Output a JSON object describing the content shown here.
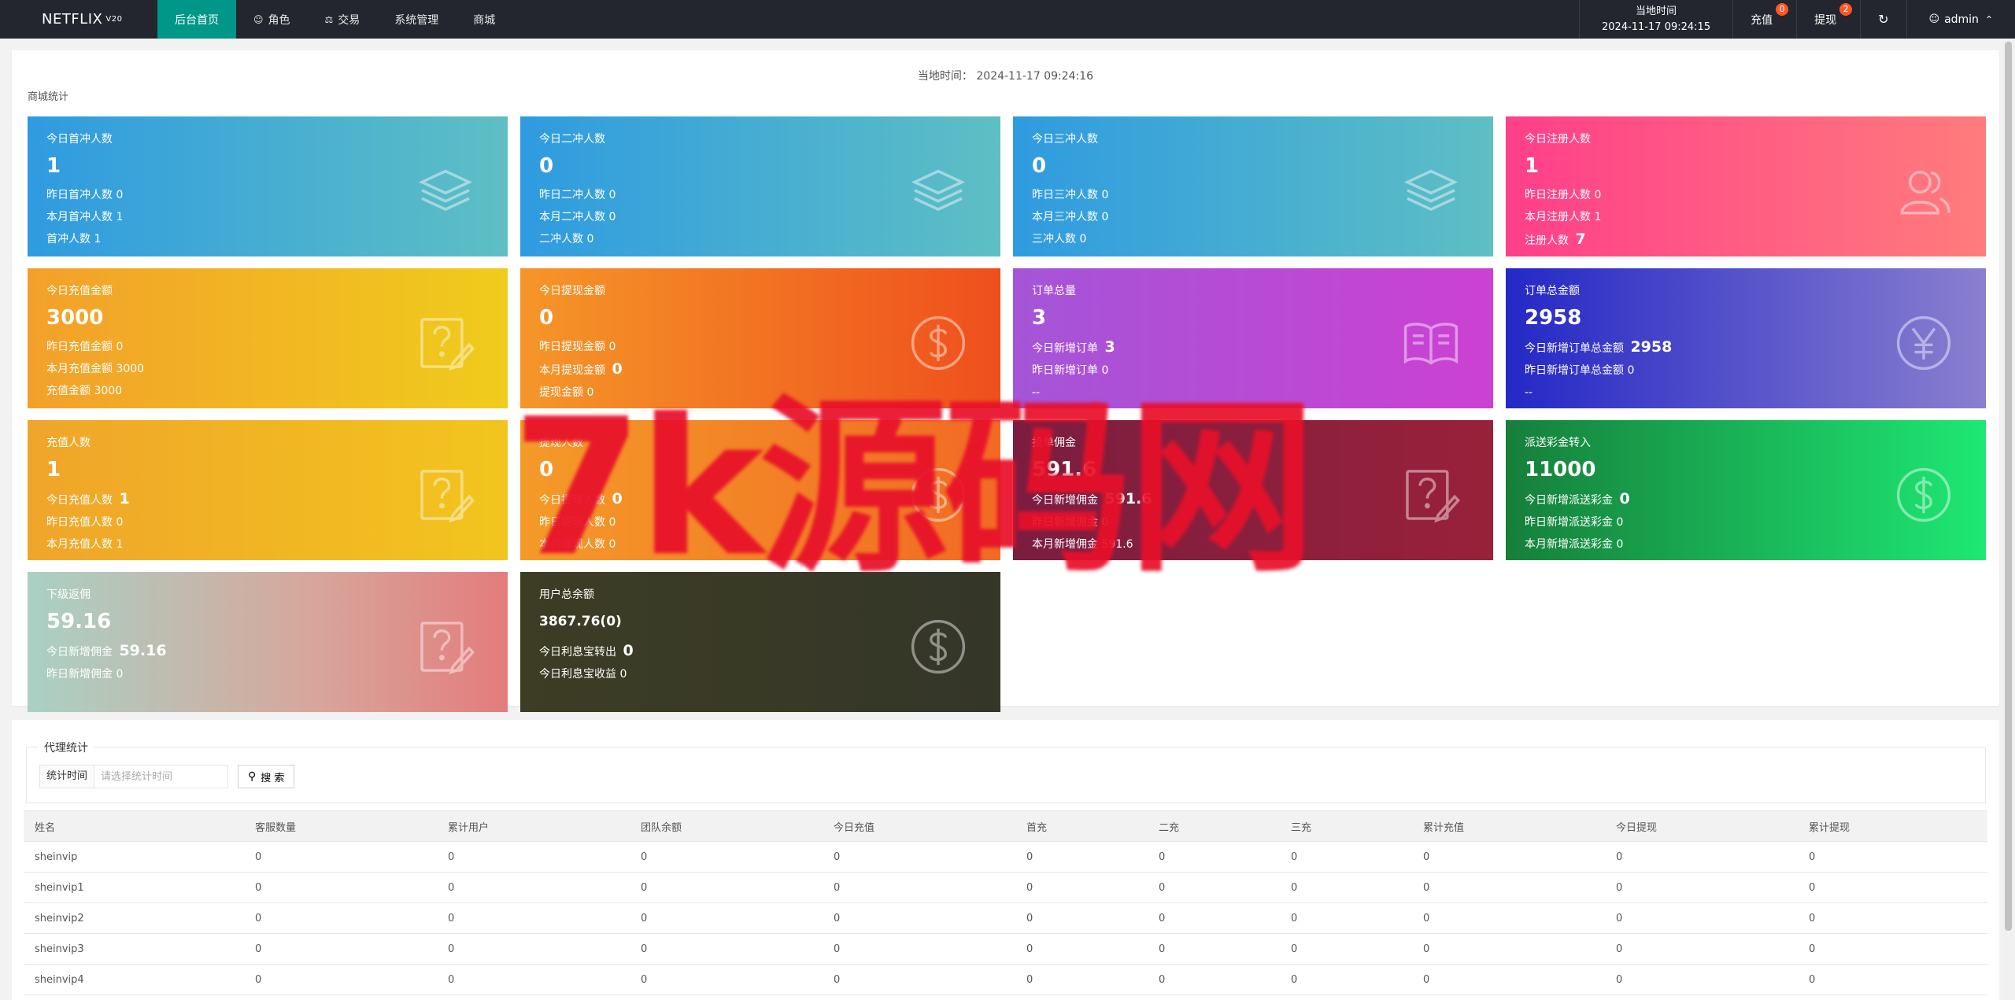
{
  "header": {
    "logo": "NETFLIX",
    "logo_version": "V20",
    "nav": [
      {
        "label": "后台首页",
        "icon": ""
      },
      {
        "label": "角色",
        "icon": "user-icon"
      },
      {
        "label": "交易",
        "icon": "scale-icon"
      },
      {
        "label": "系统管理",
        "icon": ""
      },
      {
        "label": "商城",
        "icon": ""
      }
    ],
    "time_label": "当地时间",
    "time_value": "2024-11-17 09:24:15",
    "recharge": {
      "label": "充值",
      "count": "0"
    },
    "withdraw": {
      "label": "提现",
      "count": "2"
    },
    "refresh_icon": "refresh-icon",
    "user": {
      "name": "admin",
      "icon": "user-icon"
    }
  },
  "shop": {
    "local_time_label": "当地时间：",
    "local_time_value": "2024-11-17 09:24:16",
    "section_title": "商城统计",
    "cards": [
      {
        "title": "今日首冲人数",
        "main": "1",
        "lines": [
          {
            "label": "昨日首冲人数",
            "value": "0",
            "bold": false
          },
          {
            "label": "本月首冲人数",
            "value": "1",
            "bold": false
          },
          {
            "label": "首冲人数",
            "value": "1",
            "bold": false
          }
        ],
        "icon": "layers-icon",
        "color": "#2f9be0"
      },
      {
        "title": "今日二冲人数",
        "main": "0",
        "lines": [
          {
            "label": "昨日二冲人数",
            "value": "0",
            "bold": false
          },
          {
            "label": "本月二冲人数",
            "value": "0",
            "bold": false
          },
          {
            "label": "二冲人数",
            "value": "0",
            "bold": false
          }
        ],
        "icon": "layers-icon",
        "color": "#2f9be0"
      },
      {
        "title": "今日三冲人数",
        "main": "0",
        "lines": [
          {
            "label": "昨日三冲人数",
            "value": "0",
            "bold": false
          },
          {
            "label": "本月三冲人数",
            "value": "0",
            "bold": false
          },
          {
            "label": "三冲人数",
            "value": "0",
            "bold": false
          }
        ],
        "icon": "layers-icon",
        "color": "#2f9be0"
      },
      {
        "title": "今日注册人数",
        "main": "1",
        "lines": [
          {
            "label": "昨日注册人数",
            "value": "0",
            "bold": false
          },
          {
            "label": "本月注册人数",
            "value": "1",
            "bold": false
          },
          {
            "label": "注册人数",
            "value": "7",
            "bold": true
          }
        ],
        "icon": "users-icon",
        "color": "#ff3f8a"
      },
      {
        "title": "今日充值金额",
        "main": "3000",
        "lines": [
          {
            "label": "昨日充值金额",
            "value": "0",
            "bold": false
          },
          {
            "label": "本月充值金额",
            "value": "3000",
            "bold": false
          },
          {
            "label": "充值金额",
            "value": "3000",
            "bold": false
          }
        ],
        "icon": "edit-help-icon",
        "color": "#f3a02a"
      },
      {
        "title": "今日提现金额",
        "main": "0",
        "lines": [
          {
            "label": "昨日提现金额",
            "value": "0",
            "bold": false
          },
          {
            "label": "本月提现金额",
            "value": "0",
            "bold": true
          },
          {
            "label": "提现金额",
            "value": "0",
            "bold": false
          }
        ],
        "icon": "dollar-icon",
        "color": "#f59628"
      },
      {
        "title": "订单总量",
        "main": "3",
        "lines": [
          {
            "label": "今日新增订单",
            "value": "3",
            "bold": true
          },
          {
            "label": "昨日新增订单",
            "value": "0",
            "bold": false
          },
          {
            "label": "--",
            "value": "",
            "bold": false
          }
        ],
        "icon": "book-icon",
        "color": "#a455d8"
      },
      {
        "title": "订单总金额",
        "main": "2958",
        "lines": [
          {
            "label": "今日新增订单总金额",
            "value": "2958",
            "bold": true
          },
          {
            "label": "昨日新增订单总金额",
            "value": "0",
            "bold": false
          },
          {
            "label": "--",
            "value": "",
            "bold": false
          }
        ],
        "icon": "yen-icon",
        "color": "#2428c6"
      },
      {
        "title": "充值人数",
        "main": "1",
        "lines": [
          {
            "label": "今日充值人数",
            "value": "1",
            "bold": true
          },
          {
            "label": "昨日充值人数",
            "value": "0",
            "bold": false
          },
          {
            "label": "本月充值人数",
            "value": "1",
            "bold": false
          }
        ],
        "icon": "edit-help-icon",
        "color": "#f0a52a"
      },
      {
        "title": "提现人数",
        "main": "0",
        "lines": [
          {
            "label": "今日提现人数",
            "value": "0",
            "bold": true
          },
          {
            "label": "昨日提现人数",
            "value": "0",
            "bold": false
          },
          {
            "label": "本月提现人数",
            "value": "0",
            "bold": false
          }
        ],
        "icon": "dollar-icon",
        "color": "#f49a28"
      },
      {
        "title": "抢单佣金",
        "main": "591.6",
        "lines": [
          {
            "label": "今日新增佣金",
            "value": "591.6",
            "bold": true
          },
          {
            "label": "昨日新增佣金",
            "value": "0",
            "bold": false
          },
          {
            "label": "本月新增佣金",
            "value": "591.6",
            "bold": false
          }
        ],
        "icon": "edit-help-icon",
        "color": "#7b1d40"
      },
      {
        "title": "派送彩金转入",
        "main": "11000",
        "lines": [
          {
            "label": "今日新增派送彩金",
            "value": "0",
            "bold": true
          },
          {
            "label": "昨日新增派送彩金",
            "value": "0",
            "bold": false
          },
          {
            "label": "本月新增派送彩金",
            "value": "0",
            "bold": false
          }
        ],
        "icon": "dollar-icon",
        "color": "#167f3b"
      },
      {
        "title": "下级返佣",
        "main": "59.16",
        "lines": [
          {
            "label": "今日新增佣金",
            "value": "59.16",
            "bold": true
          },
          {
            "label": "昨日新增佣金",
            "value": "0",
            "bold": false
          }
        ],
        "icon": "edit-help-icon",
        "color": "#a9d1c4"
      },
      {
        "title": "用户总余额",
        "main": "3867.76(0)",
        "main_small": true,
        "lines": [
          {
            "label": "今日利息宝转出",
            "value": "0",
            "bold": true
          },
          {
            "label": "今日利息宝收益",
            "value": "0",
            "bold": false
          }
        ],
        "icon": "dollar-icon",
        "color": "#3d3d25"
      }
    ]
  },
  "watermark": "7k源码网",
  "agent": {
    "legend": "代理统计",
    "filter_label": "统计时间",
    "filter_placeholder": "请选择统计时间",
    "search_label": "搜 索",
    "columns": [
      "姓名",
      "客服数量",
      "累计用户",
      "团队余额",
      "今日充值",
      "首充",
      "二充",
      "三充",
      "累计充值",
      "今日提现",
      "累计提现"
    ],
    "rows": [
      [
        "sheinvip",
        "0",
        "0",
        "0",
        "0",
        "0",
        "0",
        "0",
        "0",
        "0",
        "0"
      ],
      [
        "sheinvip1",
        "0",
        "0",
        "0",
        "0",
        "0",
        "0",
        "0",
        "0",
        "0",
        "0"
      ],
      [
        "sheinvip2",
        "0",
        "0",
        "0",
        "0",
        "0",
        "0",
        "0",
        "0",
        "0",
        "0"
      ],
      [
        "sheinvip3",
        "0",
        "0",
        "0",
        "0",
        "0",
        "0",
        "0",
        "0",
        "0",
        "0"
      ],
      [
        "sheinvip4",
        "0",
        "0",
        "0",
        "0",
        "0",
        "0",
        "0",
        "0",
        "0",
        "0"
      ]
    ]
  }
}
